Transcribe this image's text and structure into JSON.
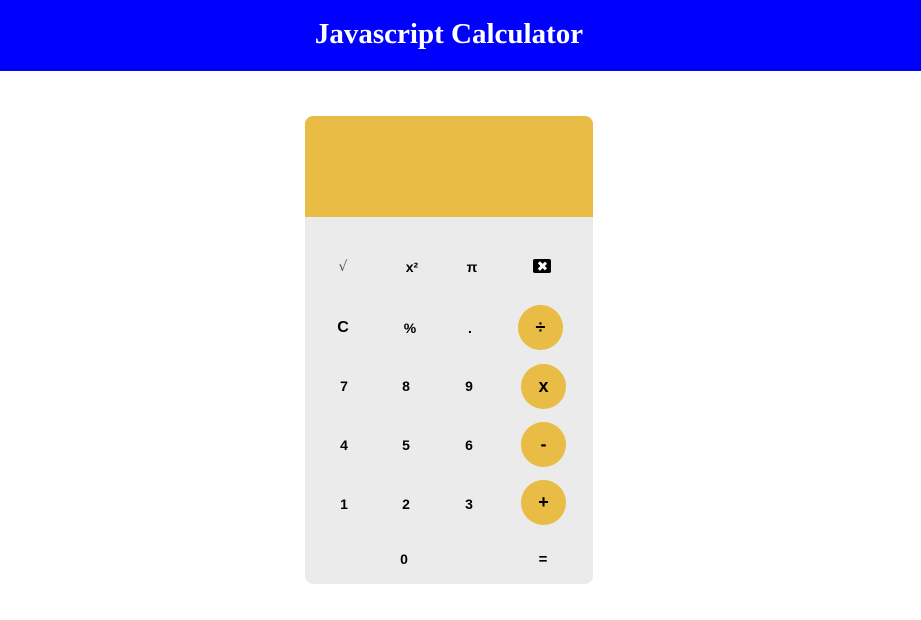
{
  "header": {
    "title": "Javascript Calculator"
  },
  "display": {
    "value": ""
  },
  "keys": {
    "sqrt": "√",
    "square": "x²",
    "pi": "π",
    "backspace_icon": "backspace-x-icon",
    "clear": "C",
    "percent": "%",
    "decimal": ".",
    "divide": "÷",
    "seven": "7",
    "eight": "8",
    "nine": "9",
    "multiply": "x",
    "four": "4",
    "five": "5",
    "six": "6",
    "subtract": "-",
    "one": "1",
    "two": "2",
    "three": "3",
    "add": "+",
    "zero": "0",
    "equals": "="
  },
  "colors": {
    "header_bg": "#0000ff",
    "accent": "#e8bc45",
    "keypad_bg": "#ebebeb"
  }
}
